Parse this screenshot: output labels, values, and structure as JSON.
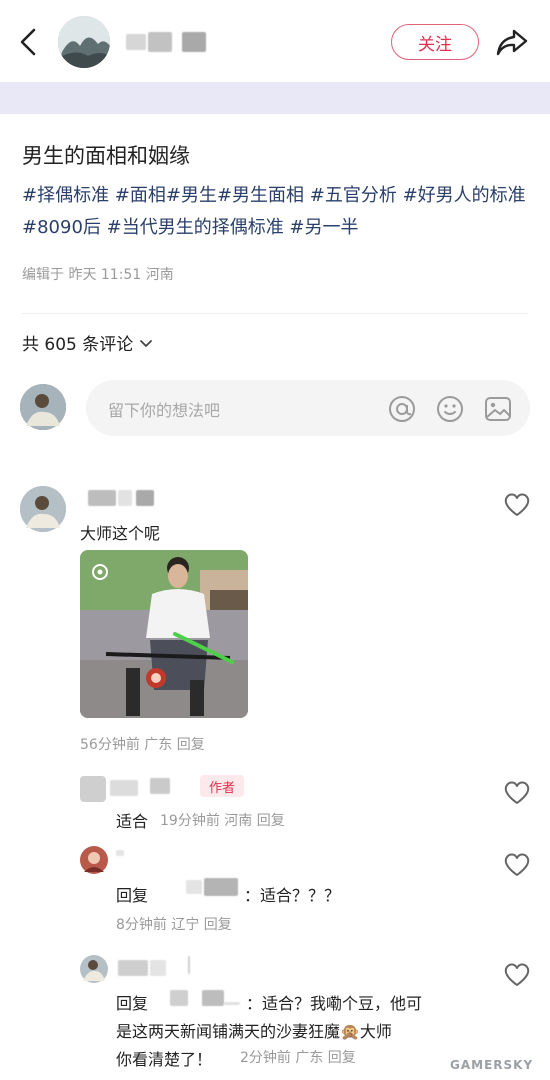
{
  "header": {
    "follow_label": "关注"
  },
  "post": {
    "title": "男生的面相和姻缘",
    "tags": "#择偶标准 #面相#男生#男生面相 #五官分析 #好男人的标准 #8090后 #当代男生的择偶标准 #另一半",
    "meta": "编辑于 昨天 11:51 河南"
  },
  "comments_header": {
    "count_label": "共 605 条评论"
  },
  "comment_input": {
    "placeholder": "留下你的想法吧"
  },
  "comments": [
    {
      "text": "大师这个呢",
      "meta": "56分钟前 广东 回复"
    }
  ],
  "replies": [
    {
      "badge": "作者",
      "text": "适合",
      "meta": "19分钟前 河南 回复"
    },
    {
      "prefix": "回复",
      "suffix": "：适合？？？",
      "meta": "8分钟前 辽宁 回复"
    },
    {
      "prefix": "回复",
      "suffix": "：适合？我嘞个豆，他可",
      "line2": "是这两天新闻铺满天的沙妻狂魔🙊大师",
      "line3": "你看清楚了！",
      "meta": "2分钟前 广东 回复"
    }
  ],
  "watermark": "GAMERSKY",
  "colors": {
    "accent": "#e0304f",
    "tag": "#2b3f6b",
    "meta": "#9a9a9a"
  }
}
